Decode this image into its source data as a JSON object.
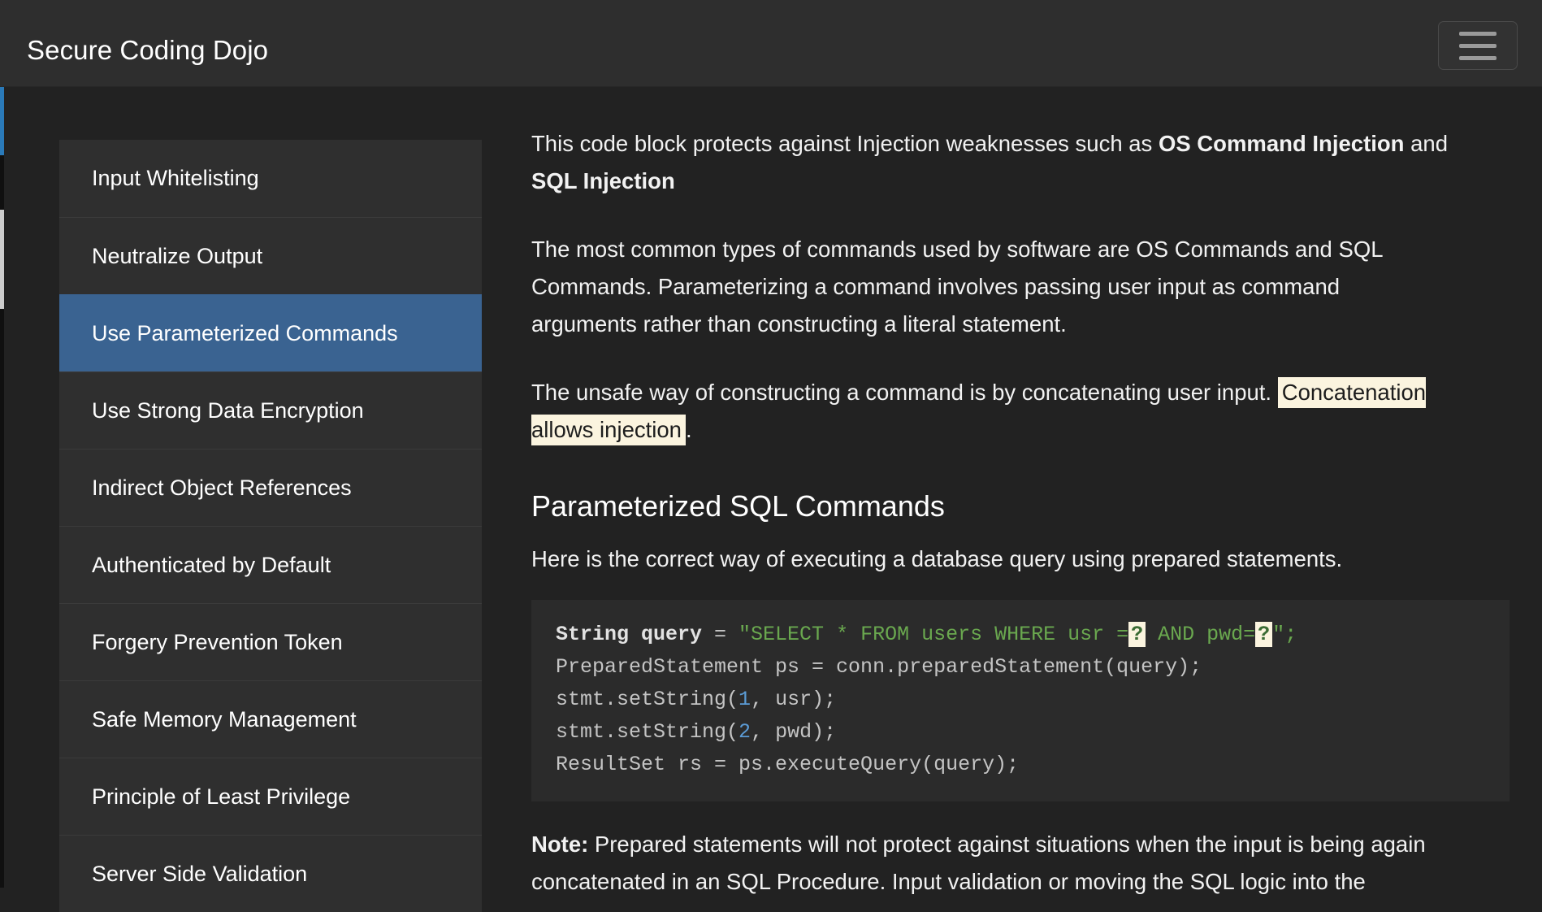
{
  "header": {
    "brand_title": "Secure Coding Dojo",
    "toggle_icon": "hamburger-menu-icon",
    "background_color": "#2e2e2e"
  },
  "edge": {
    "accent_color": "#2a7ab9",
    "scrollbar_thumb_color": "#cdcdcd"
  },
  "sidebar": {
    "active_color": "#3a6391",
    "items": [
      {
        "label": "Input Whitelisting",
        "active": false
      },
      {
        "label": "Neutralize Output",
        "active": false
      },
      {
        "label": "Use Parameterized Commands",
        "active": true
      },
      {
        "label": "Use Strong Data Encryption",
        "active": false
      },
      {
        "label": "Indirect Object References",
        "active": false
      },
      {
        "label": "Authenticated by Default",
        "active": false
      },
      {
        "label": "Forgery Prevention Token",
        "active": false
      },
      {
        "label": "Safe Memory Management",
        "active": false
      },
      {
        "label": "Principle of Least Privilege",
        "active": false
      },
      {
        "label": "Server Side Validation",
        "active": false
      }
    ]
  },
  "main": {
    "intro": {
      "part1": "This code block protects against Injection weaknesses such as ",
      "bold1": "OS Command Injection",
      "part2": " and ",
      "bold2": "SQL Injection"
    },
    "types_paragraph": "The most common types of commands used by software are OS Commands and SQL Commands. Parameterizing a command involves passing user input as command arguments rather than constructing a literal statement.",
    "unsafe": {
      "part1": "The unsafe way of constructing a command is by concatenating user input. ",
      "highlight": "Concatenation allows injection",
      "part2": "."
    },
    "section_heading": "Parameterized SQL Commands",
    "section_subtext": "Here is the correct way of executing a database query using prepared statements.",
    "code": {
      "line1": {
        "kw": "String query",
        "eq": " = ",
        "str_open": "\"SELECT * FROM users WHERE usr =",
        "q1": "?",
        "str_mid": " AND pwd=",
        "q2": "?",
        "str_close": "\";"
      },
      "line2": "PreparedStatement ps = conn.preparedStatement(query);",
      "line3_pre": "stmt.setString(",
      "line3_num": "1",
      "line3_post": ", usr);",
      "line4_pre": "stmt.setString(",
      "line4_num": "2",
      "line4_post": ", pwd);",
      "line5": "ResultSet rs = ps.executeQuery(query);"
    },
    "note": {
      "label": "Note:",
      "text": " Prepared statements will not protect against situations when the input is being again concatenated in an SQL Procedure. Input validation or moving the SQL logic into the"
    }
  }
}
